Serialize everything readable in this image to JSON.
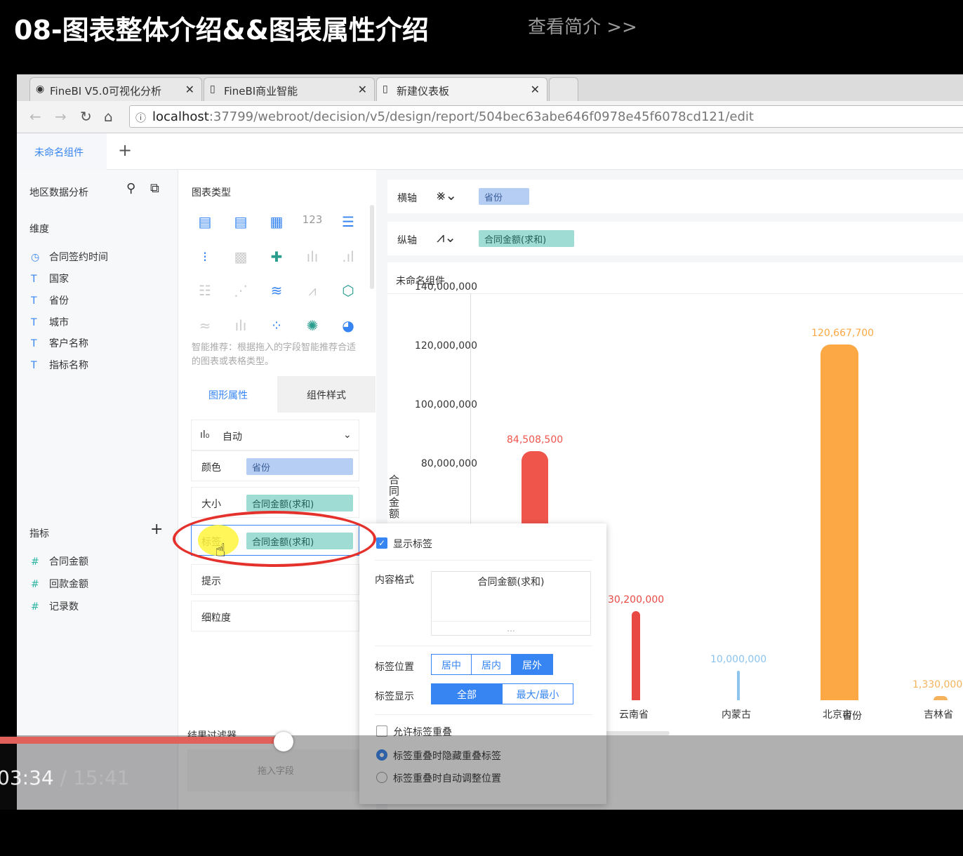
{
  "video": {
    "title": "08-图表整体介绍&&图表属性介绍",
    "intro_link": "查看简介 >>",
    "time_current": "03:34",
    "time_total": "15:41",
    "separator": "/",
    "progress": 0.228
  },
  "browser": {
    "tabs": [
      {
        "label": "FineBI V5.0可视化分析",
        "icon": "fine-icon"
      },
      {
        "label": "FineBI商业智能",
        "icon": "page-icon"
      },
      {
        "label": "新建仪表板",
        "icon": "page-icon"
      }
    ],
    "url_host": "localhost",
    "url_path": ":37799/webroot/decision/v5/design/report/504bec63abe646f0978e45f6078cd121/edit"
  },
  "component_tab": {
    "name": "未命名组件",
    "add": "+"
  },
  "left": {
    "dataset": "地区数据分析",
    "dimension_header": "维度",
    "dimensions": [
      {
        "type": "◷",
        "name": "合同签约时间"
      },
      {
        "type": "T",
        "name": "国家"
      },
      {
        "type": "T",
        "name": "省份"
      },
      {
        "type": "T",
        "name": "城市"
      },
      {
        "type": "T",
        "name": "客户名称"
      },
      {
        "type": "T",
        "name": "指标名称"
      }
    ],
    "measure_header": "指标",
    "measure_add": "+",
    "measures": [
      {
        "type": "#",
        "name": "合同金额"
      },
      {
        "type": "#",
        "name": "回款金额"
      },
      {
        "type": "#",
        "name": "记录数"
      }
    ]
  },
  "middle": {
    "chart_type_header": "图表类型",
    "recommend_text": "智能推荐：根据拖入的字段智能推荐合适的图表或表格类型。",
    "tabs": [
      "图形属性",
      "组件样式"
    ],
    "auto_label": "自动",
    "rows": [
      {
        "key": "颜色",
        "value": "省份",
        "style": "blue"
      },
      {
        "key": "大小",
        "value": "合同金额(求和)",
        "style": "teal"
      },
      {
        "key": "标签",
        "value": "合同金额(求和)",
        "style": "teal"
      },
      {
        "key": "提示",
        "value": ""
      },
      {
        "key": "细粒度",
        "value": ""
      }
    ],
    "filter_header": "结果过滤器",
    "filter_drop": "拖入字段"
  },
  "axes": {
    "x_label": "横轴",
    "x_field": "省份",
    "y_label": "纵轴",
    "y_field": "合同金额(求和)"
  },
  "chart_data": {
    "type": "bar",
    "title": "未命名组件",
    "xlabel": "省份",
    "ylabel": "合同金额",
    "ylim": [
      0,
      140000000
    ],
    "yticks": [
      "140,000,000",
      "120,000,000",
      "100,000,000",
      "80,000,000"
    ],
    "categories": [
      "",
      "云南省",
      "内蒙古",
      "北京市",
      "吉林省"
    ],
    "values": [
      84508500,
      30200000,
      10000000,
      120667700,
      1330000
    ],
    "labels": [
      "84,508,500",
      "30,200,000",
      "10,000,000",
      "120,667,700",
      "1,330,000"
    ],
    "colors": [
      "#f0554c",
      "#e84a43",
      "#8cc4ee",
      "#fba845",
      "#f5b35e"
    ]
  },
  "popup": {
    "show_label": "显示标签",
    "content_format": "内容格式",
    "content_field": "合同金额(求和)",
    "more": "...",
    "position_label": "标签位置",
    "position_options": [
      "居中",
      "居内",
      "居外"
    ],
    "display_label": "标签显示",
    "display_options": [
      "全部",
      "最大/最小"
    ],
    "allow_overlap": "允许标签重叠",
    "radio_hide": "标签重叠时隐藏重叠标签",
    "radio_adjust": "标签重叠时自动调整位置"
  }
}
